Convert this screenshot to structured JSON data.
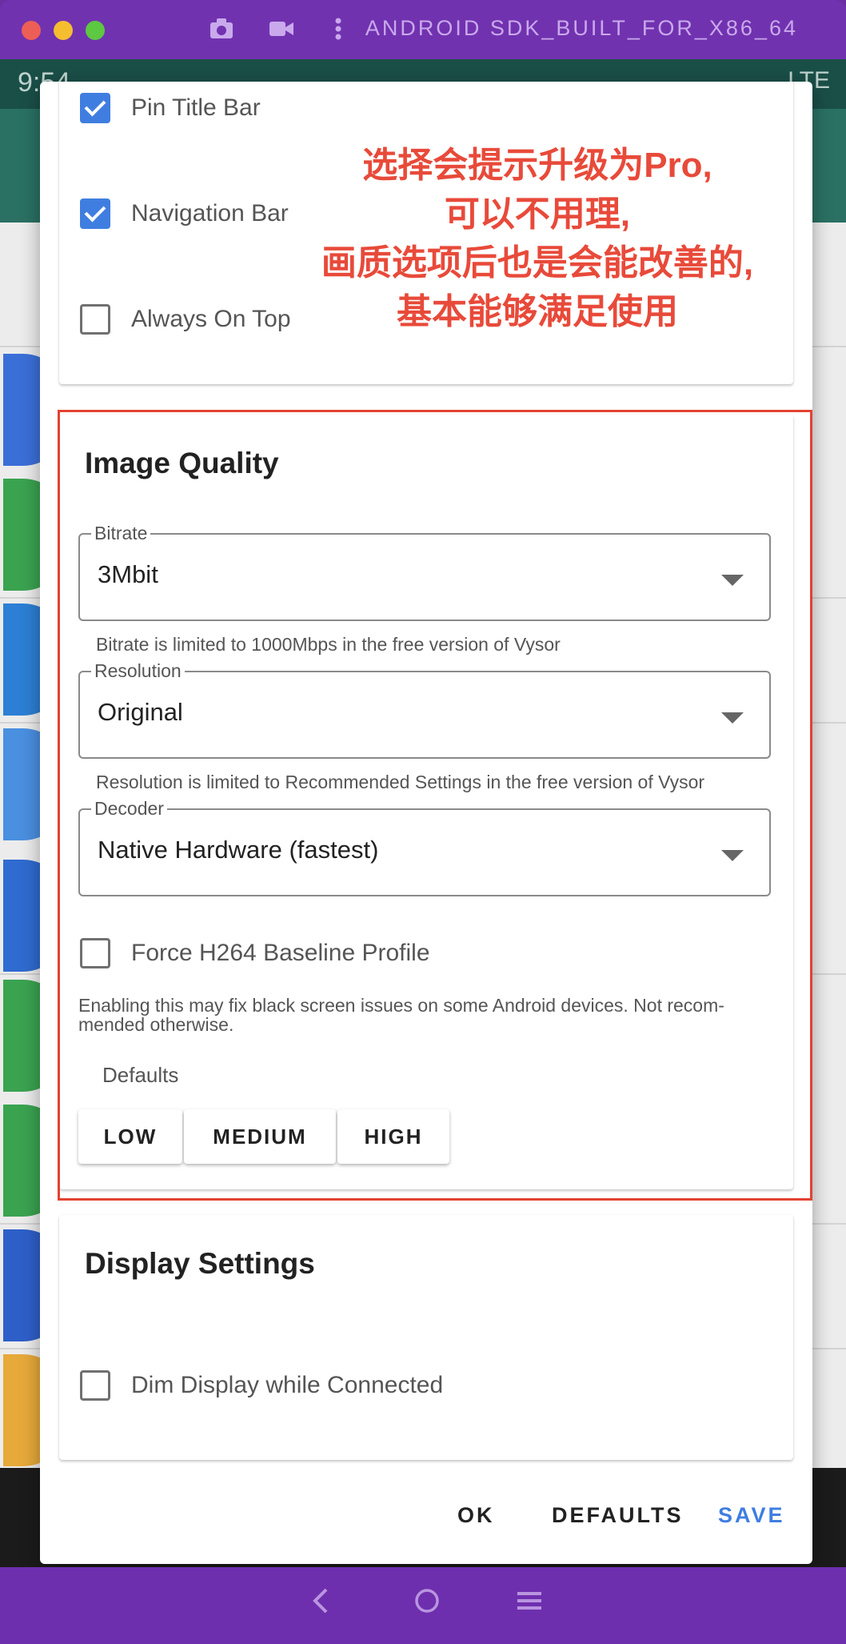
{
  "window": {
    "title": "ANDROID SDK_BUILT_FOR_X86_64"
  },
  "statusbar": {
    "time": "9:54",
    "network": "LTE"
  },
  "dialog": {
    "title_bar_section": {
      "items": [
        {
          "label": "Pin Title Bar",
          "checked": true
        },
        {
          "label": "Navigation Bar",
          "checked": true
        },
        {
          "label": "Always On Top",
          "checked": false
        }
      ]
    },
    "image_quality": {
      "title": "Image Quality",
      "bitrate": {
        "label": "Bitrate",
        "value": "3Mbit",
        "helper": "Bitrate is limited to 1000Mbps in the free version of Vysor"
      },
      "resolution": {
        "label": "Resolution",
        "value": "Original",
        "helper": "Resolution is limited to Recommended Settings in the free version of Vysor"
      },
      "decoder": {
        "label": "Decoder",
        "value": "Native Hardware (fastest)"
      },
      "force_h264": {
        "label": "Force H264 Baseline Profile",
        "checked": false,
        "note": "Enabling this may fix black screen issues on some Android devices. Not recom- mended otherwise."
      },
      "defaults_label": "Defaults",
      "presets": [
        "LOW",
        "MEDIUM",
        "HIGH"
      ]
    },
    "display_settings": {
      "title": "Display Settings",
      "dim_display": {
        "label": "Dim Display while Connected",
        "checked": false
      }
    },
    "actions": {
      "ok": "OK",
      "defaults": "DEFAULTS",
      "save": "SAVE"
    }
  },
  "annotation": {
    "lines": [
      "选择会提示升级为Pro,",
      "可以不用理,",
      "画质选项后也是会能改善的,",
      "基本能够满足使用"
    ],
    "color": "#e84a3a"
  },
  "colors": {
    "accent": "#3f7ee0",
    "window_purple": "#7132b0",
    "appbar": "#2a7163"
  }
}
